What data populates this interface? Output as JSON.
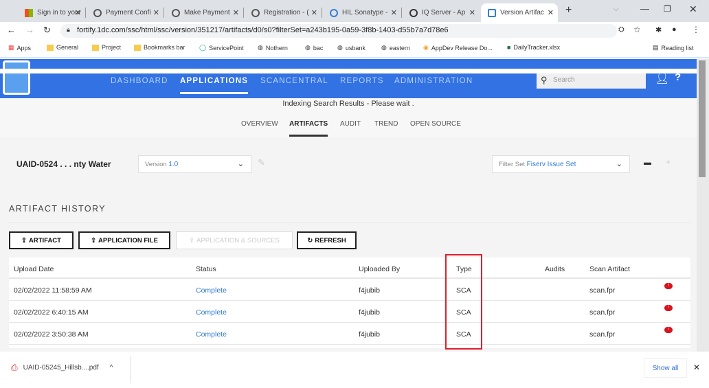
{
  "browser": {
    "tabs": [
      {
        "label": "Sign in to your",
        "icon": "microsoft-icon"
      },
      {
        "label": "Payment Confi",
        "icon": "globe-icon"
      },
      {
        "label": "Make Payment",
        "icon": "globe-icon"
      },
      {
        "label": "Registration - (",
        "icon": "globe-icon"
      },
      {
        "label": "HIL Sonatype -",
        "icon": "sonatype-icon"
      },
      {
        "label": "IQ Server - Ap",
        "icon": "iq-icon"
      },
      {
        "label": "Version Artifac",
        "icon": "fortify-icon"
      }
    ],
    "url": "fortify.1dc.com/ssc/html/ssc/version/351217/artifacts/d0/s0?filterSet=a243b195-0a59-3f8b-1403-d55b7a7d78e6",
    "bookmarks": [
      "Apps",
      "General",
      "Project",
      "Bookmarks bar",
      "ServicePoint",
      "Nothern",
      "bac",
      "usbank",
      "eastern",
      "AppDev Release Do...",
      "DailyTracker.xlsx"
    ],
    "reading_list": "Reading list"
  },
  "header": {
    "nav": [
      "DASHBOARD",
      "APPLICATIONS",
      "SCANCENTRAL",
      "REPORTS",
      "ADMINISTRATION"
    ],
    "search_placeholder": "Search"
  },
  "status_message": "Indexing Search Results - Please wait .",
  "subnav": [
    "OVERVIEW",
    "ARTIFACTS",
    "AUDIT",
    "TREND",
    "OPEN SOURCE"
  ],
  "app": {
    "name": "UAID-0524 . . . nty Water",
    "version_label": "Version",
    "version": "1.0",
    "filter_label": "Filter Set",
    "filter": "Fiserv Issue Set"
  },
  "section_title": "ARTIFACT HISTORY",
  "buttons": [
    "ARTIFACT",
    "APPLICATION FILE",
    "APPLICATION & SOURCES",
    "REFRESH"
  ],
  "table": {
    "headers": [
      "Upload Date",
      "Status",
      "Uploaded By",
      "Type",
      "Audits",
      "Scan Artifact"
    ],
    "rows": [
      [
        "02/02/2022 11:58:59 AM",
        "Complete",
        "f4jubib",
        "SCA",
        "",
        "scan.fpr"
      ],
      [
        "02/02/2022 6:40:15 AM",
        "Complete",
        "f4jubib",
        "SCA",
        "",
        "scan.fpr"
      ],
      [
        "02/02/2022 3:50:38 AM",
        "Complete",
        "f4jubib",
        "SCA",
        "",
        "scan.fpr"
      ]
    ],
    "badge": "!"
  },
  "downloads": {
    "file": "UAID-05245_Hillsb....pdf",
    "show_all": "Show all"
  }
}
